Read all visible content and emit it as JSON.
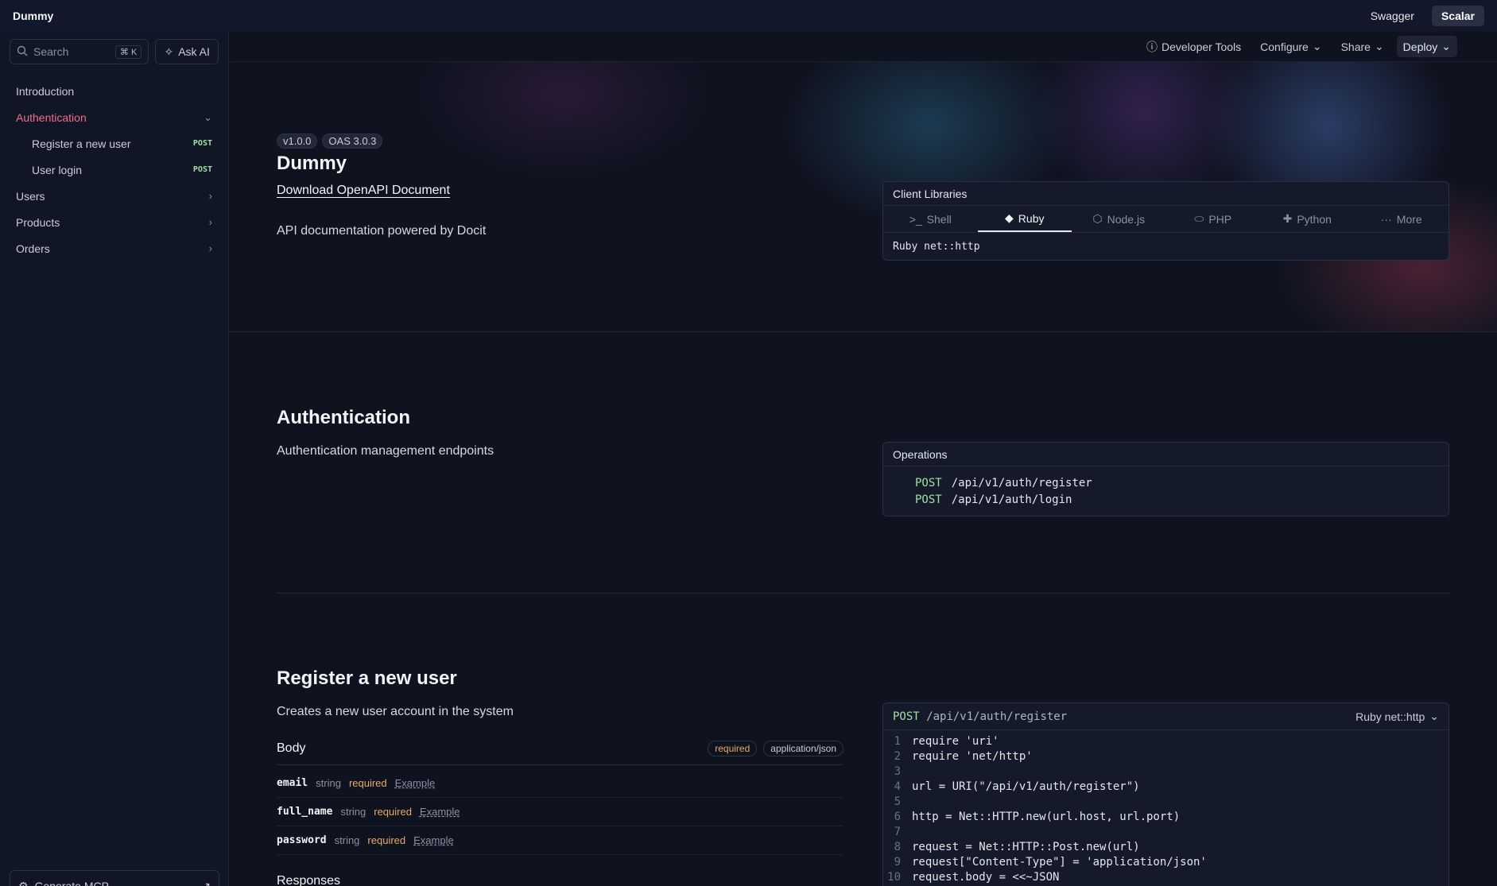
{
  "topbar": {
    "brand": "Dummy",
    "links": [
      "Swagger",
      "Scalar"
    ]
  },
  "sidebar": {
    "search_placeholder": "Search",
    "search_shortcut": "⌘ K",
    "ask_ai": "Ask AI",
    "items": [
      {
        "label": "Introduction"
      },
      {
        "label": "Authentication"
      },
      {
        "label": "Register a new user",
        "method": "POST"
      },
      {
        "label": "User login",
        "method": "POST"
      },
      {
        "label": "Users"
      },
      {
        "label": "Products"
      },
      {
        "label": "Orders"
      }
    ],
    "mcp_button": "Generate MCP"
  },
  "subbar": {
    "developer_tools": "Developer Tools",
    "configure": "Configure",
    "share": "Share",
    "deploy": "Deploy"
  },
  "intro": {
    "version": "v1.0.0",
    "oas": "OAS 3.0.3",
    "title": "Dummy",
    "download": "Download OpenAPI Document",
    "description": "API documentation powered by Docit"
  },
  "client_libraries": {
    "title": "Client Libraries",
    "tabs": [
      "Shell",
      "Ruby",
      "Node.js",
      "PHP",
      "Python",
      "More"
    ],
    "active_tab": "Ruby",
    "selected_client": "Ruby net::http"
  },
  "authentication": {
    "title": "Authentication",
    "description": "Authentication management endpoints",
    "operations_title": "Operations",
    "operations": [
      {
        "method": "POST",
        "path": "/api/v1/auth/register"
      },
      {
        "method": "POST",
        "path": "/api/v1/auth/login"
      }
    ]
  },
  "register": {
    "title": "Register a new user",
    "description": "Creates a new user account in the system",
    "body_label": "Body",
    "required_pill": "required",
    "content_type": "application/json",
    "fields": [
      {
        "name": "email",
        "type": "string",
        "required": "required",
        "example": "Example"
      },
      {
        "name": "full_name",
        "type": "string",
        "required": "required",
        "example": "Example"
      },
      {
        "name": "password",
        "type": "string",
        "required": "required",
        "example": "Example"
      }
    ],
    "responses_label": "Responses",
    "code": {
      "method": "POST",
      "path": "/api/v1/auth/register",
      "client": "Ruby net::http",
      "lines": [
        "require 'uri'",
        "require 'net/http'",
        "",
        "url = URI(\"/api/v1/auth/register\")",
        "",
        "http = Net::HTTP.new(url.host, url.port)",
        "",
        "request = Net::HTTP::Post.new(url)",
        "request[\"Content-Type\"] = 'application/json'",
        "request.body = <<~JSON"
      ]
    }
  }
}
